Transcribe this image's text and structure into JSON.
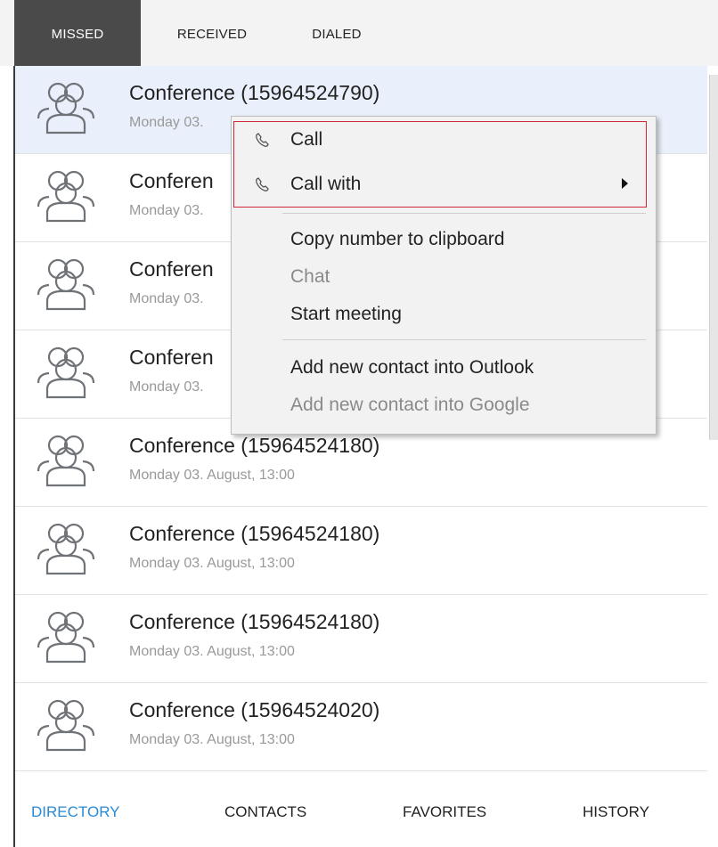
{
  "tabs": [
    {
      "label": "MISSED",
      "active": true
    },
    {
      "label": "RECEIVED",
      "active": false
    },
    {
      "label": "DIALED",
      "active": false
    }
  ],
  "calls": [
    {
      "title": "Conference (15964524790)",
      "subtitle": "Monday 03.",
      "icon": "conference-group-icon",
      "selected": true
    },
    {
      "title": "Conferen",
      "subtitle": "Monday 03.",
      "icon": "conference-group-icon",
      "selected": false
    },
    {
      "title": "Conferen",
      "subtitle": "Monday 03.",
      "icon": "conference-group-icon",
      "selected": false
    },
    {
      "title": "Conferen",
      "subtitle": "Monday 03.",
      "icon": "conference-group-icon",
      "selected": false
    },
    {
      "title": "Conference (15964524180)",
      "subtitle": "Monday 03. August, 13:00",
      "icon": "conference-group-icon",
      "selected": false
    },
    {
      "title": "Conference (15964524180)",
      "subtitle": "Monday 03. August, 13:00",
      "icon": "conference-group-icon",
      "selected": false
    },
    {
      "title": "Conference (15964524180)",
      "subtitle": "Monday 03. August, 13:00",
      "icon": "conference-group-icon",
      "selected": false
    },
    {
      "title": "Conference (15964524020)",
      "subtitle": "Monday 03. August, 13:00",
      "icon": "conference-group-icon",
      "selected": false
    }
  ],
  "context_menu": {
    "items": [
      {
        "label": "Call",
        "icon": "phone-handset-icon",
        "disabled": false,
        "submenu": false
      },
      {
        "label": "Call with",
        "icon": "phone-handset-icon",
        "disabled": false,
        "submenu": true
      },
      {
        "label": "Copy number to clipboard",
        "disabled": false
      },
      {
        "label": "Chat",
        "disabled": true
      },
      {
        "label": "Start meeting",
        "disabled": false
      },
      {
        "label": "Add new contact into Outlook",
        "disabled": false
      },
      {
        "label": "Add new contact into Google",
        "disabled": true
      }
    ],
    "highlight_color": "#d0253a"
  },
  "bottom_nav": [
    {
      "label": "DIRECTORY",
      "active": true
    },
    {
      "label": "CONTACTS",
      "active": false
    },
    {
      "label": "FAVORITES",
      "active": false
    },
    {
      "label": "HISTORY",
      "active": false
    }
  ],
  "colors": {
    "active_tab_bg": "#4a4a4a",
    "accent": "#2a8ad4",
    "selected_row": "#e9f0fb"
  }
}
